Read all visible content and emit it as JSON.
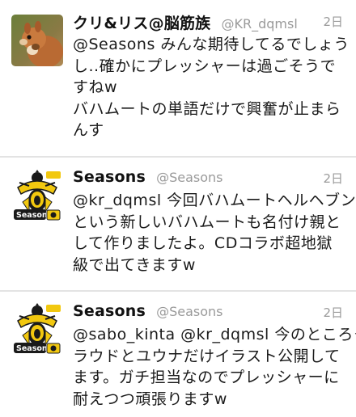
{
  "tweets": [
    {
      "display_name": "クリ&リス@脳筋族",
      "handle": "@KR_dqmsl",
      "timestamp": "2日",
      "avatar_icon": "squirrel-avatar",
      "lines": [
        "@Seasons みんな期待してるでしょう",
        "し..確かにプレッシャーは過ごそうで",
        "すねw",
        "バハムートの単語だけで興奮が止まら",
        "んす"
      ]
    },
    {
      "display_name": "Seasons",
      "handle": "@Seasons",
      "timestamp": "2日",
      "avatar_icon": "seasons-logo-avatar",
      "avatar_label": "Seasons",
      "lines": [
        "@kr_dqmsl 今回バハムートヘルヘブン",
        "という新しいバハムートも名付け親と",
        "して作りましたよ。CDコラボ超地獄",
        "級で出てきますw"
      ]
    },
    {
      "display_name": "Seasons",
      "handle": "@Seasons",
      "timestamp": "2日",
      "avatar_icon": "seasons-logo-avatar",
      "avatar_label": "Seasons",
      "lines": [
        "@sabo_kinta @kr_dqmsl 今のところク",
        "ラウドとユウナだけイラスト公開して",
        "ます。ガチ担当なのでプレッシャーに",
        "耐えつつ頑張りますw"
      ]
    }
  ],
  "colors": {
    "name": "#111111",
    "handle": "#9a9a9a",
    "divider": "#e3e3e3",
    "avatar_yellow": "#f2c80f"
  }
}
